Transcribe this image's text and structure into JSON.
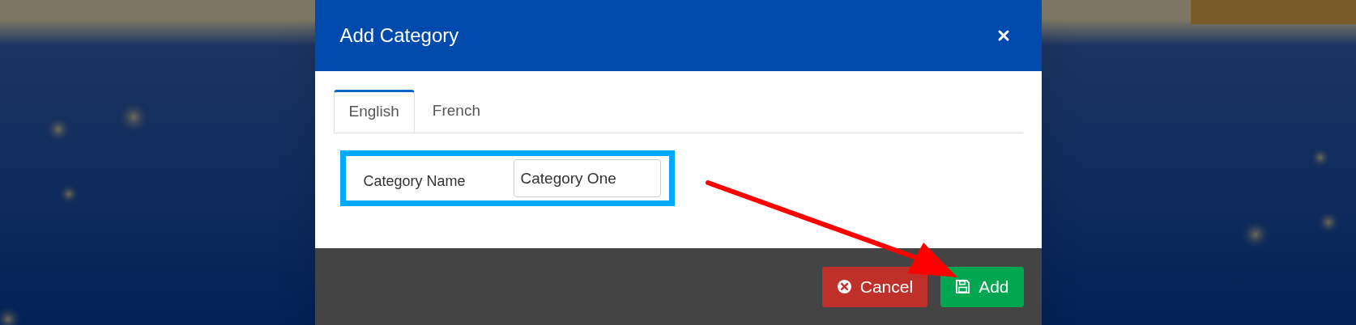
{
  "dialog": {
    "title": "Add Category",
    "tabs": [
      {
        "label": "English",
        "selected": true
      },
      {
        "label": "French",
        "selected": false
      }
    ],
    "field": {
      "label": "Category Name",
      "value": "Category One",
      "highlighted": true
    },
    "buttons": [
      {
        "kind": "cancel",
        "label": "Cancel"
      },
      {
        "kind": "add",
        "label": "Add"
      }
    ]
  }
}
